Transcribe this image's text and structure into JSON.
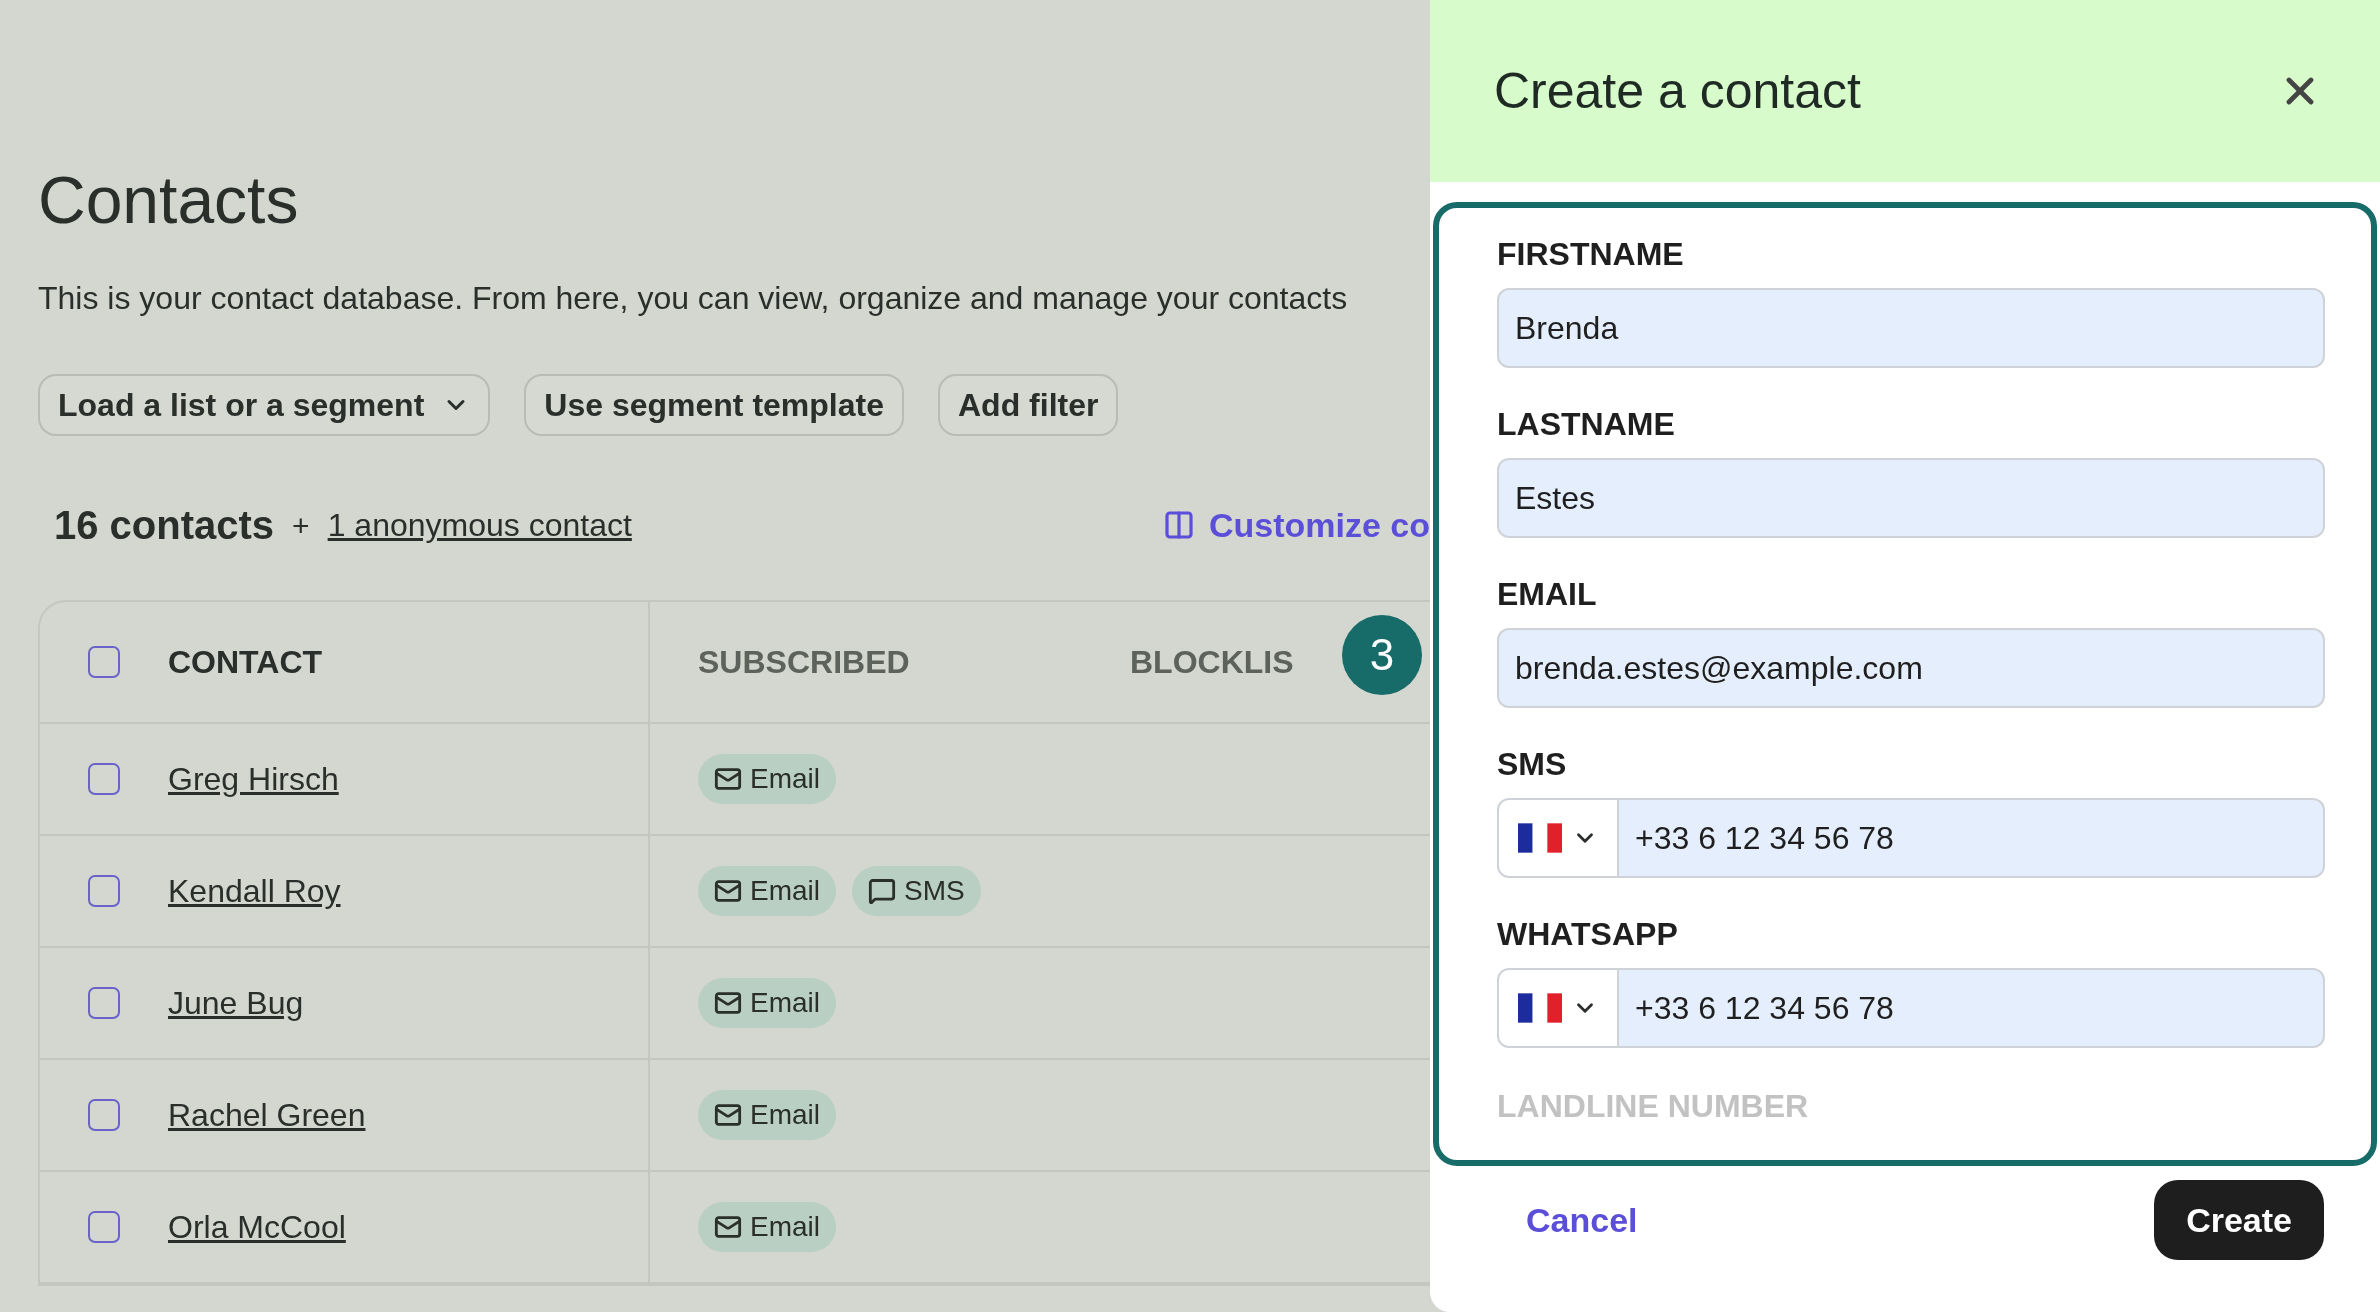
{
  "page": {
    "title": "Contacts",
    "description": "This is your contact database. From here, you can view, organize and manage your contacts"
  },
  "toolbar": [
    {
      "label": "Load a list or a segment",
      "kind": "dropdown"
    },
    {
      "label": "Use segment template",
      "kind": "button"
    },
    {
      "label": "Add filter",
      "kind": "button"
    }
  ],
  "summary": {
    "count": "16 contacts",
    "plus": "+",
    "anonymous_link": "1 anonymous contact",
    "customize": "Customize co"
  },
  "table": {
    "header_checked": false,
    "columns": [
      "CONTACT",
      "SUBSCRIBED",
      "BLOCKLIS"
    ],
    "rows": [
      {
        "name": "Greg Hirsch",
        "checked": false,
        "channels": [
          {
            "kind": "email",
            "label": "Email"
          }
        ]
      },
      {
        "name": "Kendall Roy",
        "checked": false,
        "channels": [
          {
            "kind": "email",
            "label": "Email"
          },
          {
            "kind": "sms",
            "label": "SMS"
          }
        ]
      },
      {
        "name": "June Bug",
        "checked": false,
        "channels": [
          {
            "kind": "email",
            "label": "Email"
          }
        ]
      },
      {
        "name": "Rachel Green",
        "checked": false,
        "channels": [
          {
            "kind": "email",
            "label": "Email"
          }
        ]
      },
      {
        "name": "Orla McCool",
        "checked": false,
        "channels": [
          {
            "kind": "email",
            "label": "Email"
          }
        ]
      }
    ]
  },
  "step_badge": "3",
  "drawer": {
    "title": "Create a contact",
    "fields": [
      {
        "label": "FIRSTNAME",
        "kind": "text",
        "value": "Brenda"
      },
      {
        "label": "LASTNAME",
        "kind": "text",
        "value": "Estes"
      },
      {
        "label": "EMAIL",
        "kind": "text",
        "value": "brenda.estes@example.com"
      },
      {
        "label": "SMS",
        "kind": "phone",
        "value": "+33 6 12 34 56 78"
      },
      {
        "label": "WHATSAPP",
        "kind": "phone",
        "value": "+33 6 12 34 56 78"
      },
      {
        "label": "LANDLINE NUMBER",
        "kind": "cut"
      }
    ],
    "cancel": "Cancel",
    "create": "Create"
  }
}
